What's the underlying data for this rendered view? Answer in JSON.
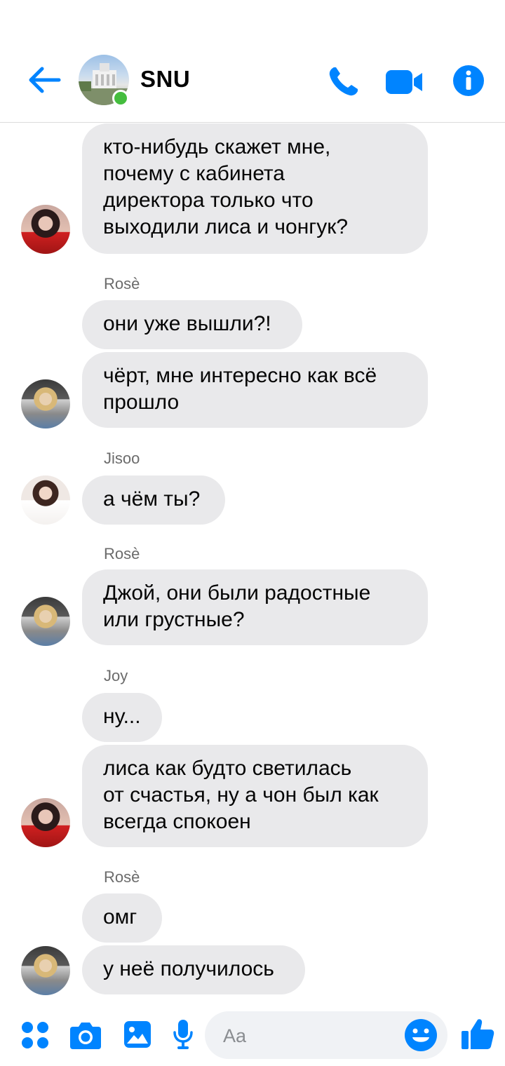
{
  "colors": {
    "accent": "#0084ff",
    "bubble_bg": "#e9e9eb",
    "online": "#45bd3e"
  },
  "header": {
    "title": "SNU",
    "icons": [
      "back-arrow-icon",
      "phone-icon",
      "video-camera-icon",
      "info-icon"
    ]
  },
  "messages": [
    {
      "sender": "",
      "text": "кто-нибудь скажет мне,\nпочему с кабинета\nдиректора только что\nвыходили лиса и чонгук?"
    },
    {
      "sender": "Rosè",
      "text": "они уже вышли?!"
    },
    {
      "sender": "",
      "text": "чёрт, мне интересно как всё\nпрошло"
    },
    {
      "sender": "Jisoo",
      "text": "а чём ты?"
    },
    {
      "sender": "Rosè",
      "text": "Джой, они были радостные\nили грустные?"
    },
    {
      "sender": "Joy",
      "text": "ну..."
    },
    {
      "sender": "",
      "text": "лиса как будто светилась\nот счастья, ну а чон был как\nвсегда спокоен"
    },
    {
      "sender": "Rosè",
      "text": "омг"
    },
    {
      "sender": "",
      "text": "у неё получилось"
    }
  ],
  "composer": {
    "placeholder": "Aa",
    "icons": [
      "apps-grid-icon",
      "camera-icon",
      "gallery-icon",
      "microphone-icon",
      "emoji-icon",
      "thumbs-up-icon"
    ]
  }
}
